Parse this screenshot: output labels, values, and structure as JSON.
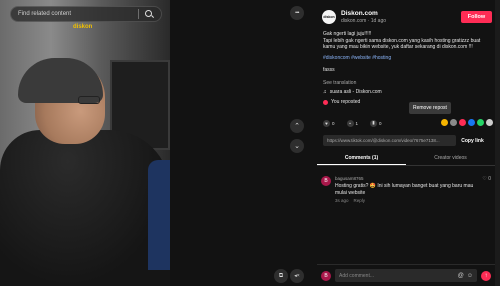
{
  "video": {
    "watermark": "diskon",
    "search_placeholder": "Find related content",
    "more_label": "•••",
    "nav_up": "⌃",
    "nav_down": "⌄",
    "icon_a": "⧉",
    "icon_b": "◂×"
  },
  "author": {
    "avatar": "diskon",
    "name": "Diskon.com",
    "sub": "diskon.com · 1d ago",
    "follow_label": "Follow"
  },
  "post": {
    "desc_line1": "Gak ngerti lagi juju!!!!!",
    "desc_line2": "Tapi lebih gak ngerti sama diskon.com yang kasih hosting gratizzz buat kamu yang mau bikin website, yuk daftar sekarang di diskon.com !!!",
    "tags": "#diskoncom #website #hosting",
    "extra": "fasss",
    "see_translation": "See translation",
    "sound_icon": "♫",
    "sound": "suara asli - Diskon.com",
    "repost_label": "You reposted",
    "tooltip": "Remove repost"
  },
  "actions": {
    "likes": "0",
    "comments": "1",
    "saves": "0",
    "like_icon": "♥",
    "comment_icon": "•",
    "save_icon": "▮"
  },
  "share_colors": [
    "#f5b400",
    "#8a8a8a",
    "#fe2c55",
    "#1877f2",
    "#25d366",
    "#cccccc"
  ],
  "link": {
    "url": "https://www.tiktok.com/@diskon.com/video/7675e7138...",
    "copy_label": "Copy link"
  },
  "tabs": [
    {
      "label": "Comments (1)"
    },
    {
      "label": "Creator videos"
    }
  ],
  "comment": {
    "avatar": "B",
    "user": "bagusam8765",
    "text": "Hosting gratis? 🤩 Ini sih lumayan banget buat yang baru mau mulai website",
    "time": "3s ago",
    "reply": "Reply",
    "like_icon": "♡",
    "likes": "0"
  },
  "addbar": {
    "avatar": "B",
    "placeholder": "Add comment...",
    "mention_icon": "@",
    "emoji_icon": "☺",
    "send_icon": "↑"
  }
}
